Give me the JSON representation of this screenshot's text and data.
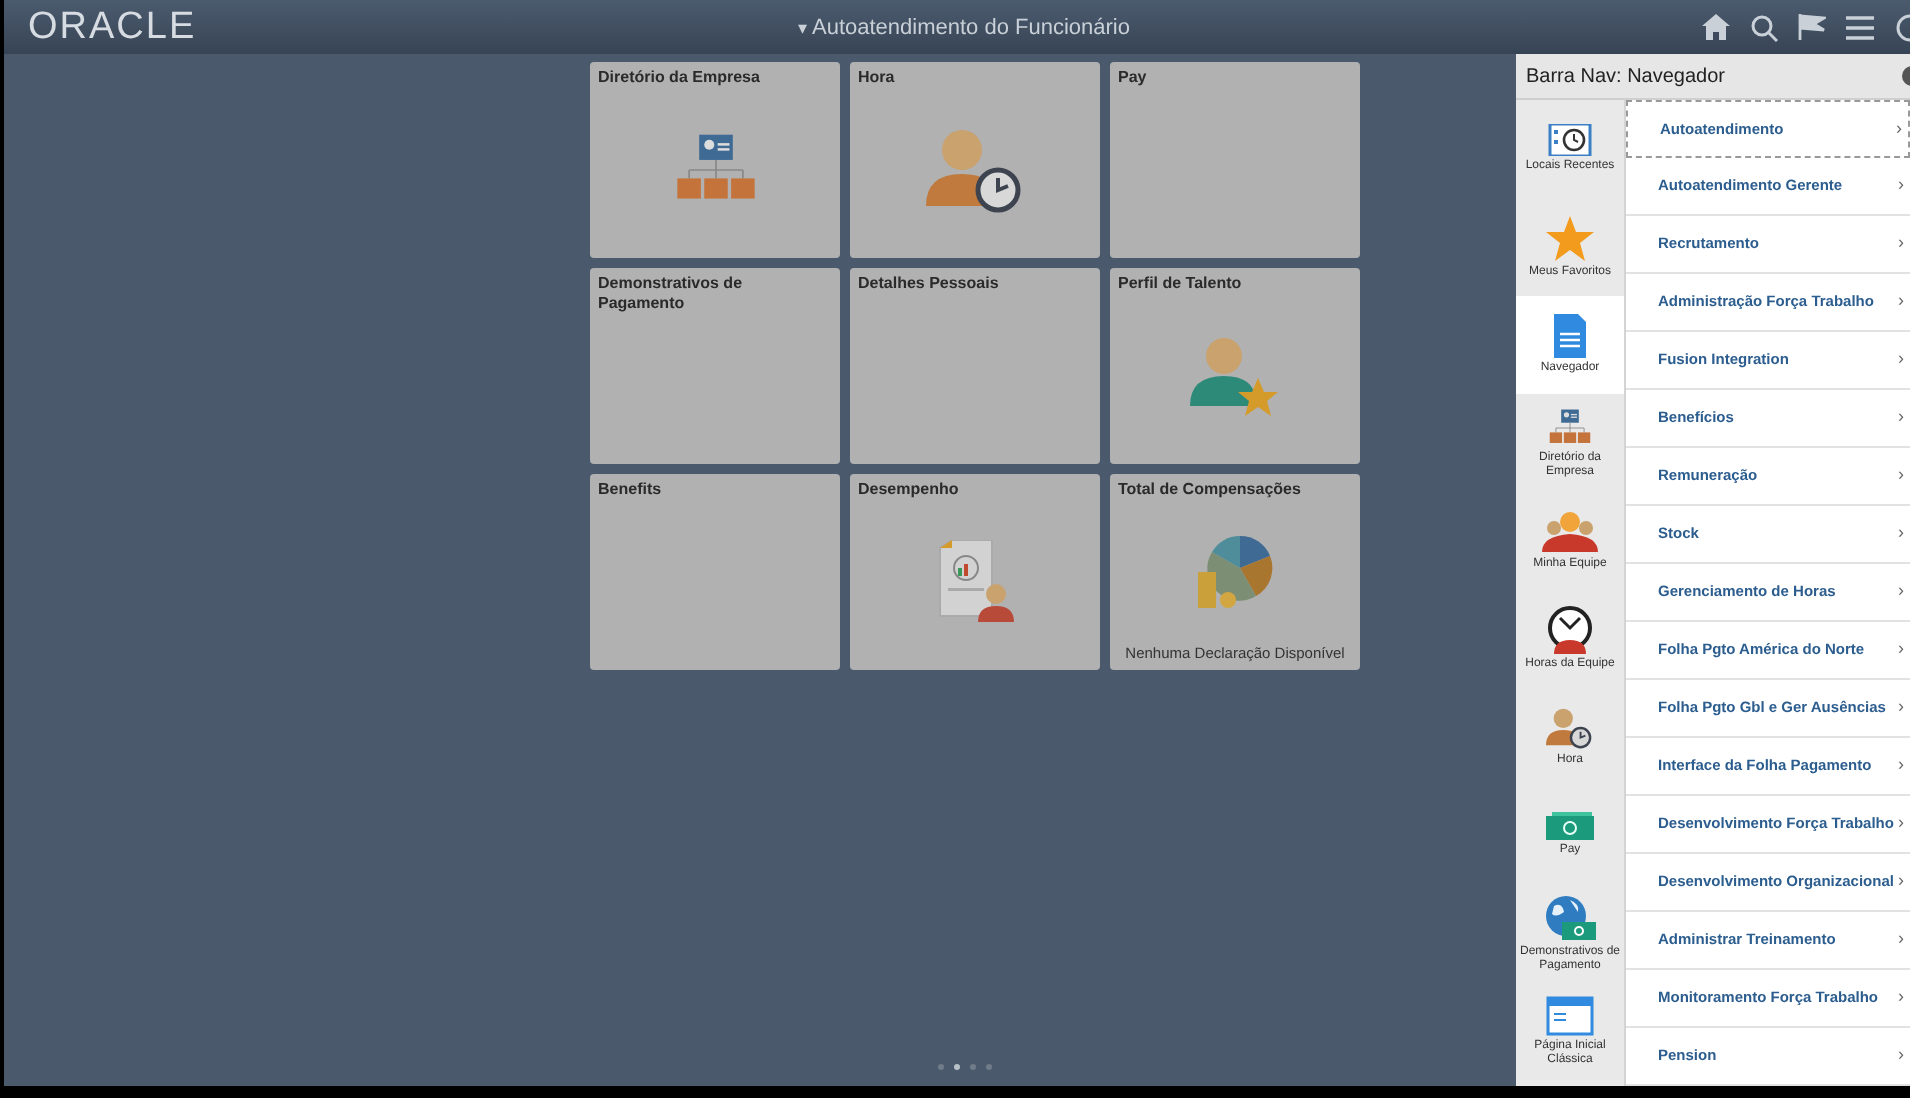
{
  "header": {
    "logo": "ORACLE",
    "title_caret": "▾",
    "title": "Autoatendimento do Funcionário"
  },
  "tiles": [
    {
      "title": "Diretório da Empresa",
      "kind": "directory"
    },
    {
      "title": "Hora",
      "kind": "time"
    },
    {
      "title": "Pay",
      "kind": "none"
    },
    {
      "title": "Demonstrativos de Pagamento",
      "kind": "none"
    },
    {
      "title": "Detalhes Pessoais",
      "kind": "none"
    },
    {
      "title": "Perfil de Talento",
      "kind": "talent"
    },
    {
      "title": "Benefits",
      "kind": "none"
    },
    {
      "title": "Desempenho",
      "kind": "performance"
    },
    {
      "title": "Total de Compensações",
      "kind": "compensation",
      "note": "Nenhuma Declaração Disponível"
    }
  ],
  "pager": [
    {
      "selected": false
    },
    {
      "selected": true
    },
    {
      "selected": false
    },
    {
      "selected": false
    }
  ],
  "nav_panel": {
    "title": "Barra Nav: Navegador",
    "sidebar": [
      {
        "label": "Locais Recentes",
        "kind": "recent",
        "selected": false
      },
      {
        "label": "Meus Favoritos",
        "kind": "favorites",
        "selected": false
      },
      {
        "label": "Navegador",
        "kind": "navigator",
        "selected": true
      },
      {
        "label": "Diretório da Empresa",
        "kind": "directory",
        "selected": false
      },
      {
        "label": "Minha Equipe",
        "kind": "team",
        "selected": false
      },
      {
        "label": "Horas da Equipe",
        "kind": "teamtime",
        "selected": false
      },
      {
        "label": "Hora",
        "kind": "time",
        "selected": false
      },
      {
        "label": "Pay",
        "kind": "pay",
        "selected": false
      },
      {
        "label": "Demonstrativos de Pagamento",
        "kind": "statements",
        "selected": false
      },
      {
        "label": "Página Inicial Clássica",
        "kind": "classic",
        "selected": false
      }
    ],
    "menu": [
      {
        "label": "Autoatendimento",
        "focused": true
      },
      {
        "label": "Autoatendimento Gerente",
        "focused": false
      },
      {
        "label": "Recrutamento",
        "focused": false
      },
      {
        "label": "Administração Força Trabalho",
        "focused": false
      },
      {
        "label": "Fusion Integration",
        "focused": false
      },
      {
        "label": "Benefícios",
        "focused": false
      },
      {
        "label": "Remuneração",
        "focused": false
      },
      {
        "label": "Stock",
        "focused": false
      },
      {
        "label": "Gerenciamento de Horas",
        "focused": false
      },
      {
        "label": "Folha Pgto América do Norte",
        "focused": false
      },
      {
        "label": "Folha Pgto Gbl e Ger Ausências",
        "focused": false
      },
      {
        "label": "Interface da Folha Pagamento",
        "focused": false
      },
      {
        "label": "Desenvolvimento Força Trabalho",
        "focused": false
      },
      {
        "label": "Desenvolvimento Organizacional",
        "focused": false
      },
      {
        "label": "Administrar Treinamento",
        "focused": false
      },
      {
        "label": "Monitoramento Força Trabalho",
        "focused": false
      },
      {
        "label": "Pension",
        "focused": false
      }
    ],
    "chevron": "›"
  }
}
